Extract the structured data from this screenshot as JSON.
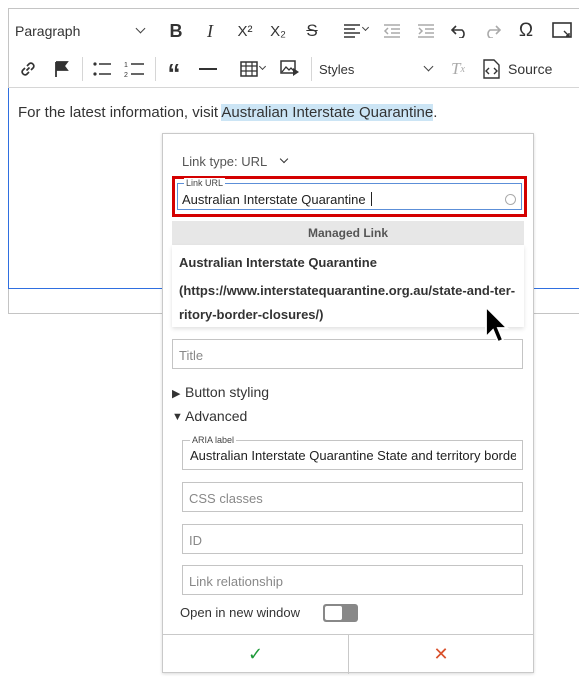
{
  "toolbar": {
    "paragraph_label": "Paragraph",
    "styles_label": "Styles",
    "source_label": "Source",
    "superscript_label": "X²",
    "subscript_label": "X₂"
  },
  "editor": {
    "text_before": "For the latest information, visit ",
    "selected_text": "Australian Interstate Quarantine",
    "text_after": "."
  },
  "link_panel": {
    "link_type_label": "Link type: URL",
    "url_label": "Link URL",
    "url_value": "Australian Interstate Quarantine",
    "managed_label": "Managed Link",
    "suggestion_title": "Australian Interstate Quarantine",
    "suggestion_url_line1": "(https://www.interstatequarantine.org.au/state-and-ter-",
    "suggestion_url_line2": "ritory-border-closures/)",
    "title_placeholder": "Title",
    "button_styling_label": "Button styling",
    "advanced_label": "Advanced",
    "aria_label": "ARIA label",
    "aria_value": "Australian Interstate Quarantine State and territory borde",
    "css_placeholder": "CSS classes",
    "id_placeholder": "ID",
    "rel_placeholder": "Link relationship",
    "new_window_label": "Open in new window",
    "new_window_on": false,
    "save_symbol": "✓",
    "cancel_symbol": "✕"
  },
  "colors": {
    "highlight": "#cce5f5",
    "focus_border": "#d40000",
    "save": "#1f9a3a",
    "cancel": "#d9502b"
  }
}
